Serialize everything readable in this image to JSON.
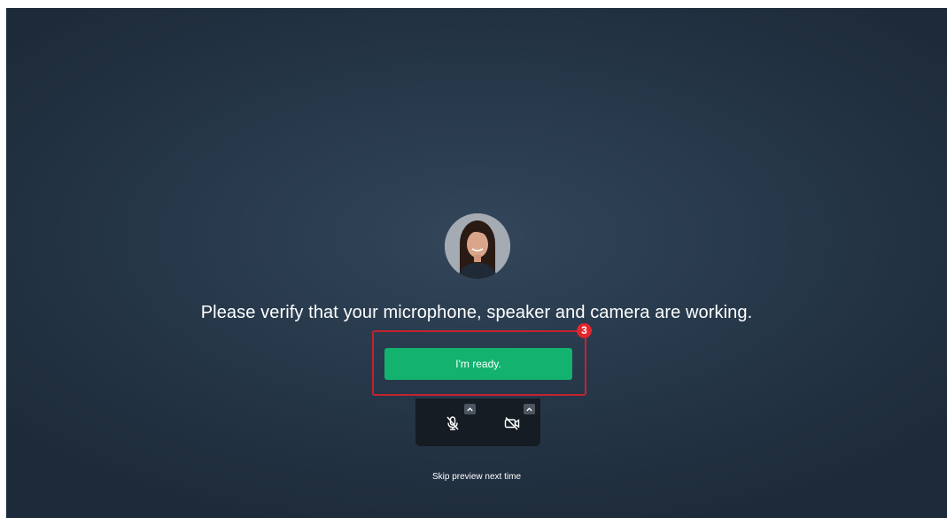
{
  "preview": {
    "avatar_icon": "user-avatar-photo",
    "prompt": "Please verify that your microphone, speaker and camera are working.",
    "ready_button": "I'm ready.",
    "step_badge": "3",
    "skip_link": "Skip preview next time"
  },
  "controls": {
    "mic_icon": "microphone-muted-icon",
    "camera_icon": "camera-off-icon",
    "options_icon": "chevron-up-icon"
  },
  "colors": {
    "accent_green": "#13b26f",
    "highlight_red": "#c4232f",
    "badge_red": "#e1262d",
    "background_center": "#33465a",
    "background_edge": "#1d2a39"
  }
}
